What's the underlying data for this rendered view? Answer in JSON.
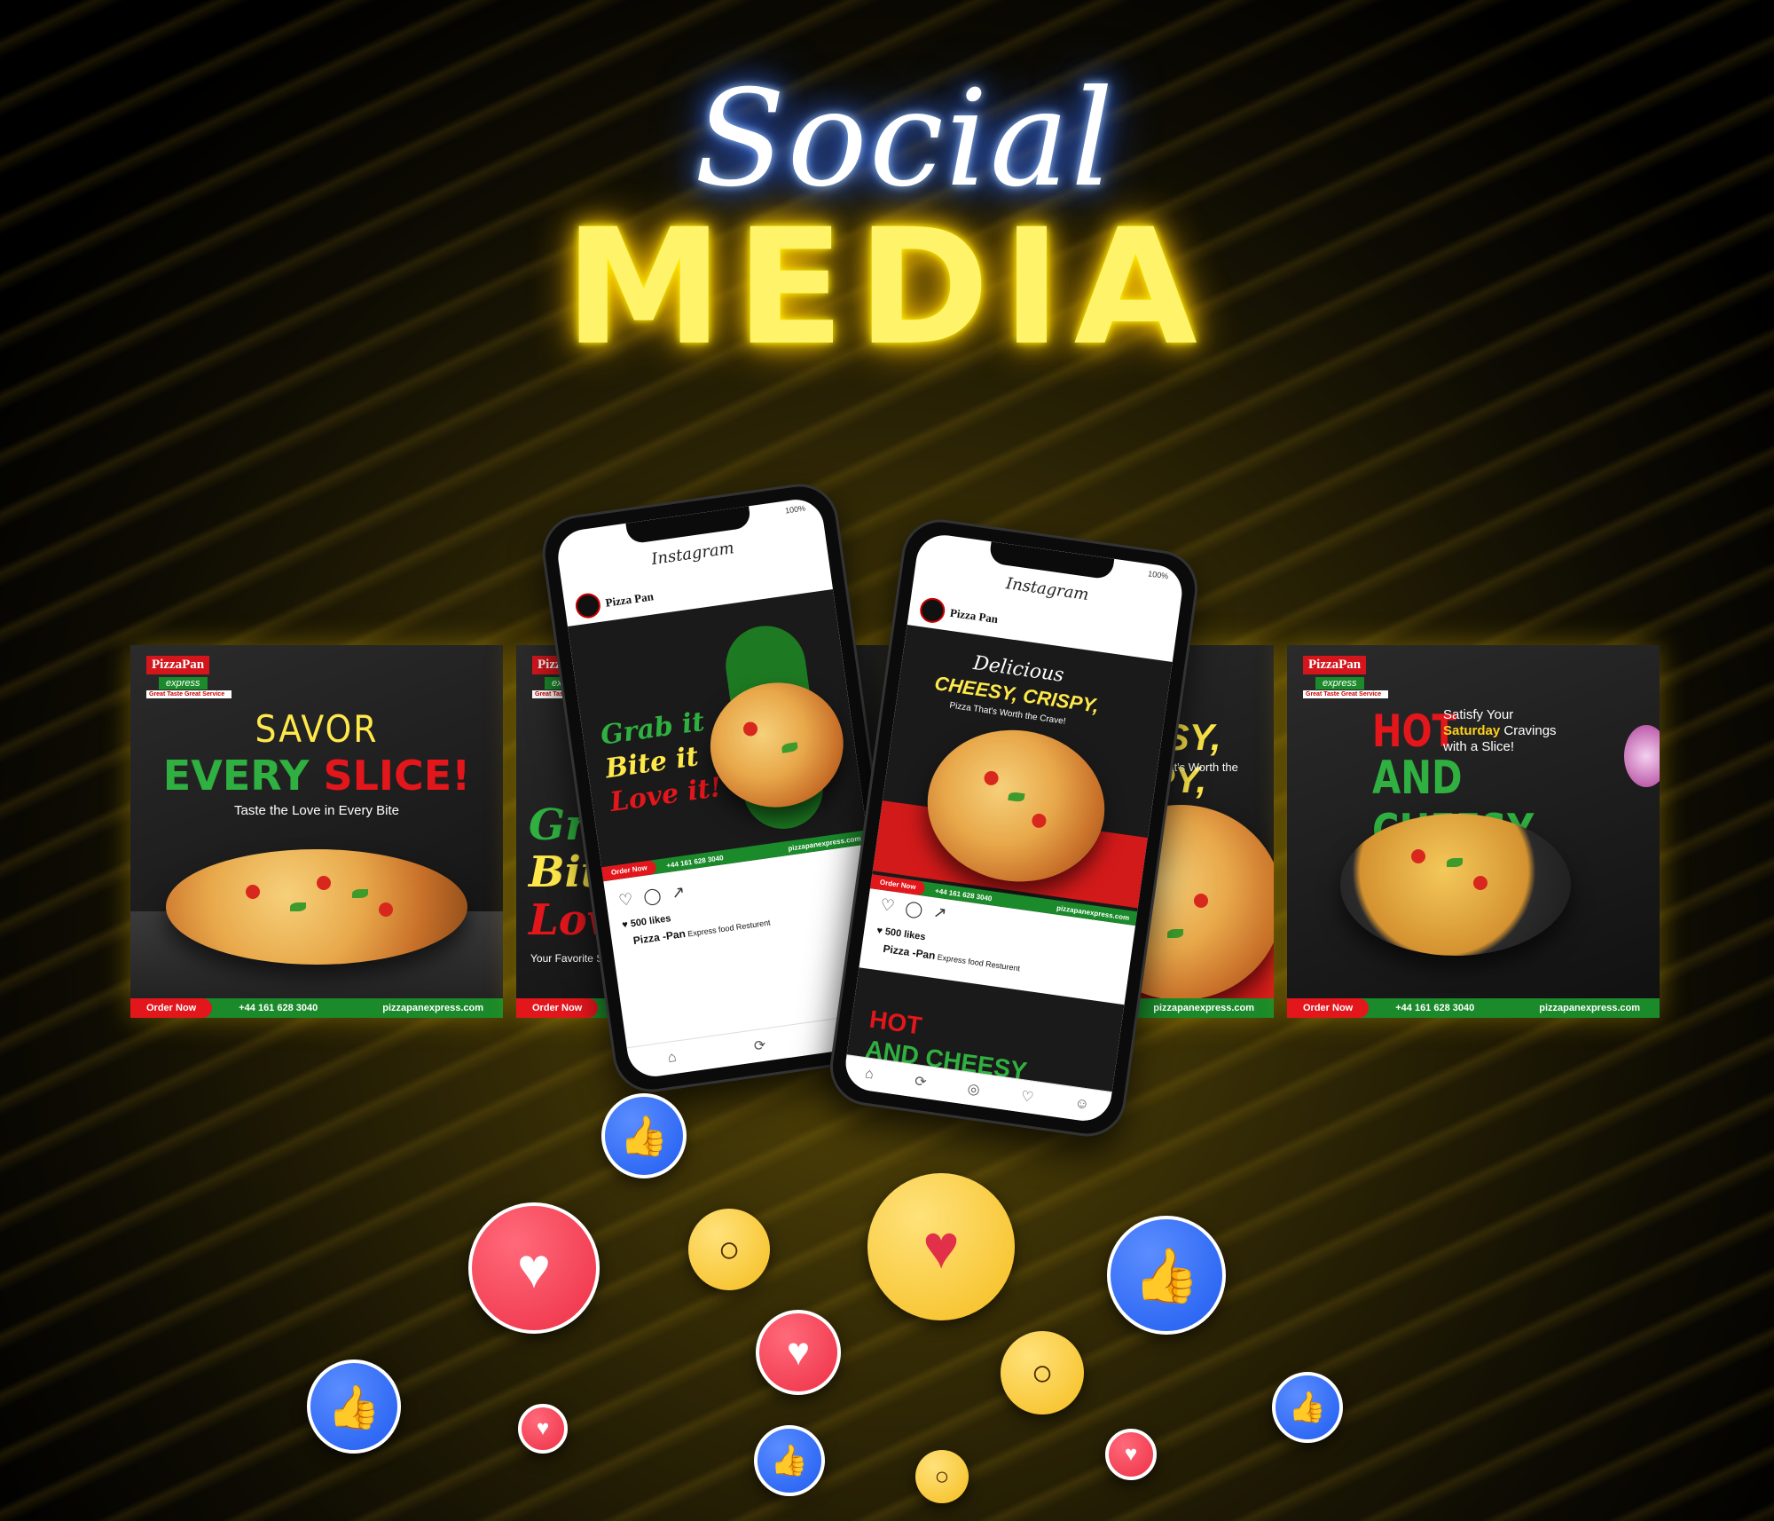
{
  "headline": {
    "script": "Social",
    "block": "MEDIA"
  },
  "brand": {
    "name": "PizzaPan",
    "sub": "express",
    "tagline": "Great Taste Great Service"
  },
  "footer": {
    "order": "Order Now",
    "phone": "+44 161 628 3040",
    "web": "pizzapanexpress.com"
  },
  "posts": [
    {
      "line1": "SAVOR",
      "line2a": "EVERY ",
      "line2b": "SLICE!",
      "line3": "Taste the Love in Every Bite"
    },
    {
      "line1": "Grab it",
      "line2": "Bite it",
      "line3": "Love it!",
      "line4": "Your Favorite Slice, Every Time!"
    },
    {
      "line1": "Delicious",
      "line2": "CHEESY, CRISPY,",
      "line3": "Pizza That's Worth the Crave!"
    },
    {
      "big1": "HOT",
      "big2": "AND CHEESY",
      "side1": "Satisfy Your",
      "side2a": "Saturday",
      "side2b": " Cravings",
      "side3": "with a Slice!"
    }
  ],
  "phones": [
    {
      "app": "Instagram",
      "account": "Pizza Pan",
      "likes": "500 likes",
      "caption_bold": "Pizza -Pan",
      "caption": " Express food Resturent",
      "battery": "100%"
    },
    {
      "app": "Instagram",
      "account": "Pizza Pan",
      "likes": "500 likes",
      "caption_bold": "Pizza -Pan",
      "caption": " Express food Resturent",
      "battery": "100%"
    }
  ],
  "colors": {
    "neon_yellow": "#fff36a",
    "neon_blue": "#3d7bff",
    "brand_red": "#e3161c",
    "brand_green": "#1a8a2a",
    "like_blue": "#1f5cf0",
    "heart_red": "#ee2f46",
    "emoji_yellow": "#f5bd1f"
  }
}
